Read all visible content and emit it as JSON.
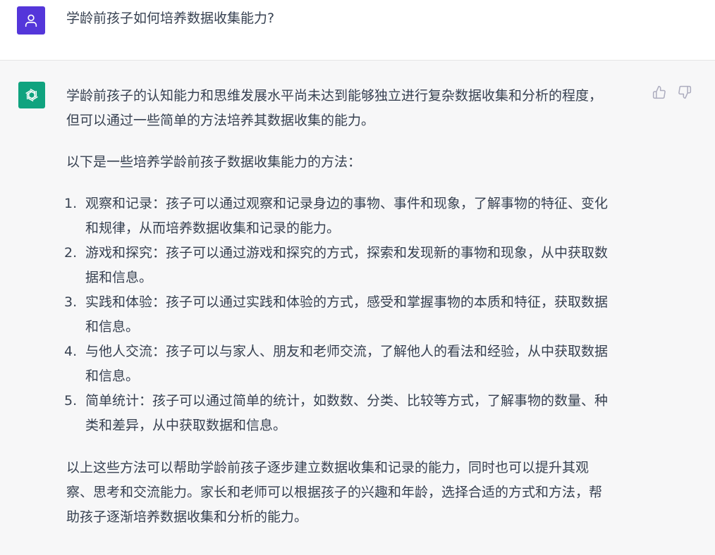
{
  "colors": {
    "user_avatar": "#5436da",
    "assistant_avatar": "#10a37f",
    "text": "#374151",
    "icon": "#acacbe"
  },
  "user": {
    "avatar_icon": "person-icon",
    "question": "学龄前孩子如何培养数据收集能力?"
  },
  "assistant": {
    "avatar_icon": "openai-logo-icon",
    "intro_line1": "学龄前孩子的认知能力和思维发展水平尚未达到能够独立进行复杂数据收集和分析的程度，",
    "intro_line2": "但可以通过一些简单的方法培养其数据收集的能力。",
    "lead": "以下是一些培养学龄前孩子数据收集能力的方法：",
    "items": [
      {
        "num": "1.",
        "line1": "观察和记录：孩子可以通过观察和记录身边的事物、事件和现象，了解事物的特征、变化",
        "line2": "和规律，从而培养数据收集和记录的能力。"
      },
      {
        "num": "2.",
        "line1": "游戏和探究：孩子可以通过游戏和探究的方式，探索和发现新的事物和现象，从中获取数",
        "line2": "据和信息。"
      },
      {
        "num": "3.",
        "line1": "实践和体验：孩子可以通过实践和体验的方式，感受和掌握事物的本质和特征，获取数据",
        "line2": "和信息。"
      },
      {
        "num": "4.",
        "line1": "与他人交流：孩子可以与家人、朋友和老师交流，了解他人的看法和经验，从中获取数据",
        "line2": "和信息。"
      },
      {
        "num": "5.",
        "line1": "简单统计：孩子可以通过简单的统计，如数数、分类、比较等方式，了解事物的数量、种",
        "line2": "类和差异，从中获取数据和信息。"
      }
    ],
    "conclusion_line1": "以上这些方法可以帮助学龄前孩子逐步建立数据收集和记录的能力，同时也可以提升其观",
    "conclusion_line2": "察、思考和交流能力。家长和老师可以根据孩子的兴趣和年龄，选择合适的方式和方法，帮",
    "conclusion_line3": "助孩子逐渐培养数据收集和分析的能力。"
  },
  "actions": {
    "thumbs_up_icon": "thumbs-up-icon",
    "thumbs_down_icon": "thumbs-down-icon"
  }
}
